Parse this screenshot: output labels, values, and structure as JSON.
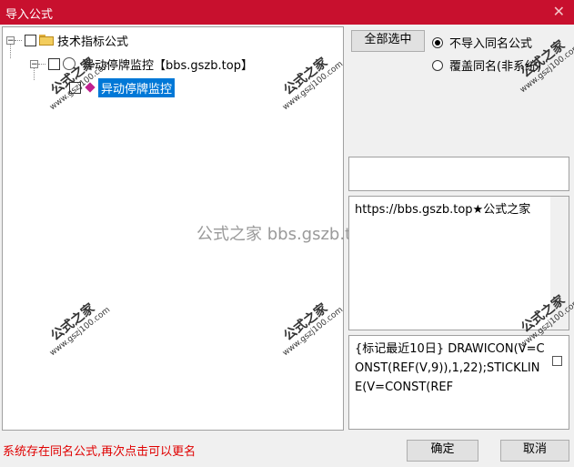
{
  "window": {
    "title": "导入公式"
  },
  "tree": {
    "root": {
      "label": "技术指标公式"
    },
    "group": {
      "label": "异动停牌监控【bbs.gszb.top】"
    },
    "item": {
      "label": "异动停牌监控"
    }
  },
  "options": {
    "select_all_label": "全部选中",
    "radio_no_import": "不导入同名公式",
    "radio_overwrite": "覆盖同名(非系统)"
  },
  "description": {
    "text": "https://bbs.gszb.top★公式之家"
  },
  "code": {
    "text": "{标记最近10日} DRAWICON(V=CONST(REF(V,9)),1,22);STICKLINE(V=CONST(REF"
  },
  "status": {
    "message": "系统存在同名公式,再次点击可以更名"
  },
  "buttons": {
    "ok": "确定",
    "cancel": "取消"
  },
  "watermarks": {
    "line1": "公式之家",
    "line2": "www.gszj100.com",
    "center": "公式之家 bbs.gszb.top"
  },
  "colors": {
    "titlebar": "#c8102e",
    "selection": "#0078d7",
    "status_text": "#e00000"
  }
}
